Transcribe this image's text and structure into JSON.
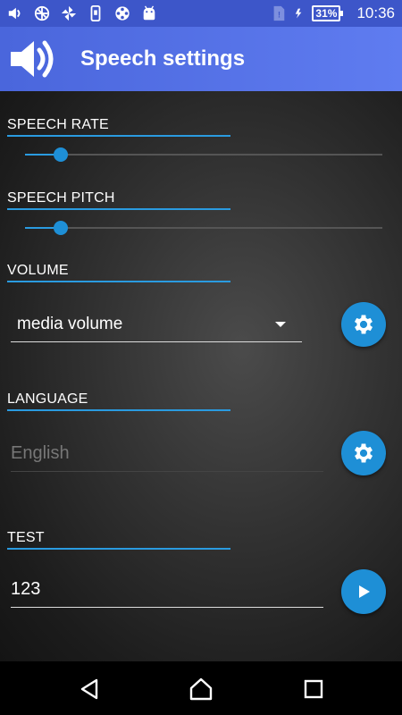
{
  "status_bar": {
    "icons": [
      "volume-icon",
      "wheel-icon",
      "pinwheel-icon",
      "phone-icon",
      "film-reel-icon",
      "android-icon",
      "sim-card-icon",
      "charging-icon"
    ],
    "battery": "31%",
    "time": "10:36"
  },
  "app_bar": {
    "title": "Speech settings",
    "icon": "speaker-icon"
  },
  "speech_rate": {
    "label": "SPEECH RATE",
    "value_fraction": 0.1
  },
  "speech_pitch": {
    "label": "SPEECH PITCH",
    "value_fraction": 0.1
  },
  "volume": {
    "label": "VOLUME",
    "selected": "media volume",
    "settings_icon": "gear-icon"
  },
  "language": {
    "label": "LANGUAGE",
    "placeholder": "English",
    "settings_icon": "gear-icon"
  },
  "test": {
    "label": "TEST",
    "value": "123",
    "play_icon": "play-icon"
  },
  "nav_bar": {
    "back": "back-icon",
    "home": "home-icon",
    "recents": "recents-icon"
  },
  "colors": {
    "accent": "#1e8fd6",
    "app_bar": "#4a66dc",
    "status_bar": "#3d56c9"
  }
}
